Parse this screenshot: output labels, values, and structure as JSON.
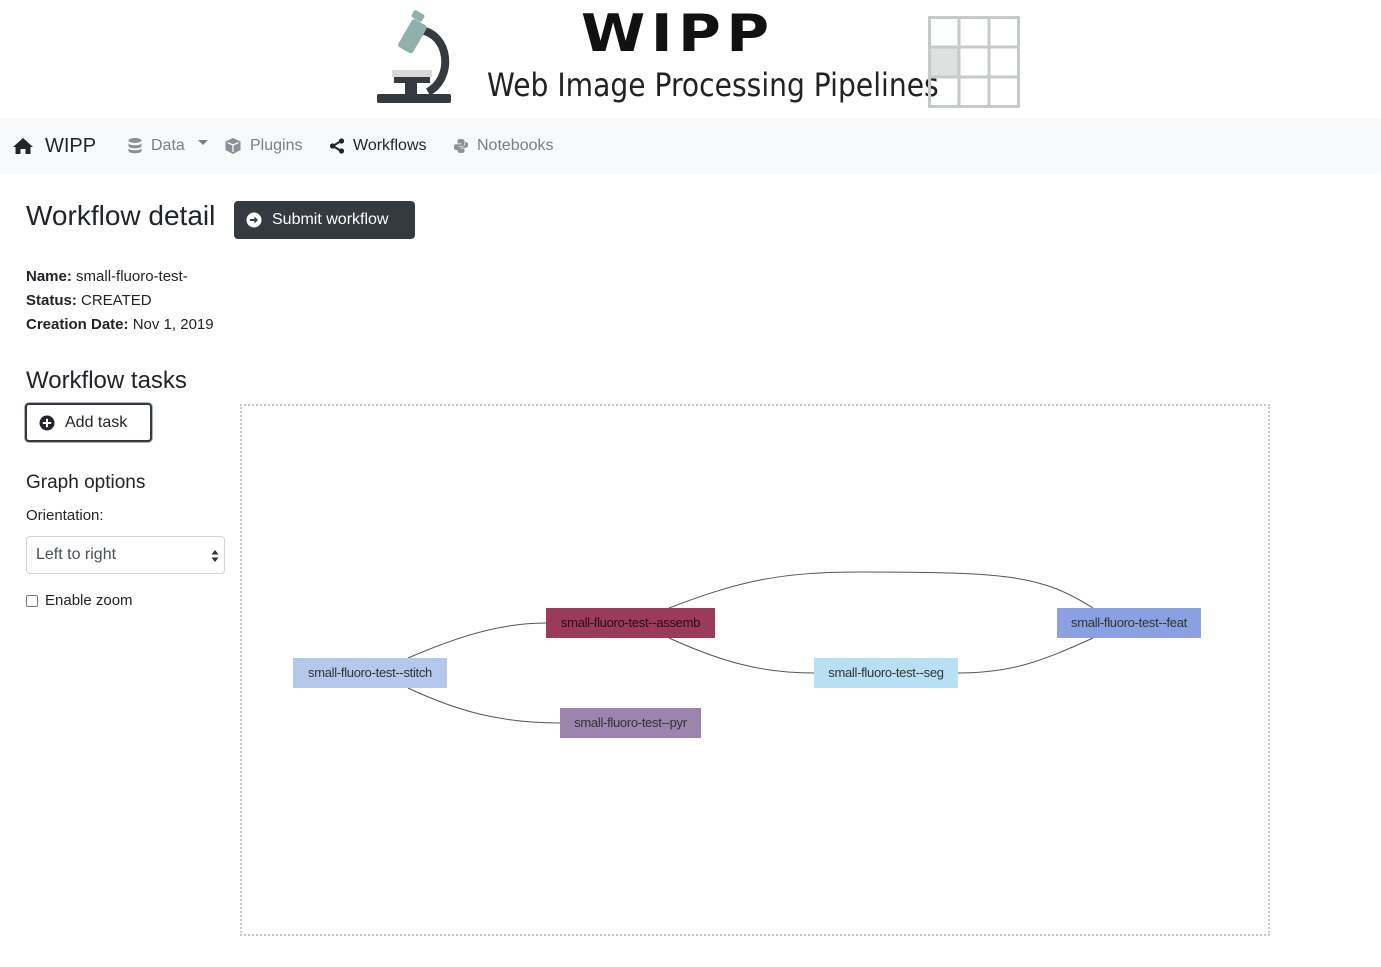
{
  "banner": {
    "wordmark": "WIPP",
    "subtitle": "Web Image Processing Pipelines"
  },
  "navbar": {
    "brand": "WIPP",
    "items": [
      {
        "label": "Data",
        "icon": "database-icon",
        "has_dropdown": true
      },
      {
        "label": "Plugins",
        "icon": "cube-icon"
      },
      {
        "label": "Workflows",
        "icon": "share-nodes-icon",
        "active": true
      },
      {
        "label": "Notebooks",
        "icon": "python-icon"
      }
    ]
  },
  "page": {
    "title": "Workflow detail",
    "submit_label": "Submit workflow"
  },
  "workflow": {
    "name_label": "Name:",
    "name": "small-fluoro-test-",
    "status_label": "Status:",
    "status": "CREATED",
    "date_label": "Creation Date:",
    "date": "Nov 1, 2019"
  },
  "tasks": {
    "title": "Workflow tasks",
    "add_label": "Add task"
  },
  "graph_options": {
    "title": "Graph options",
    "orientation_label": "Orientation:",
    "orientation_value": "Left to right",
    "zoom_label": "Enable zoom",
    "zoom_enabled": false
  },
  "graph": {
    "nodes": [
      {
        "id": "stitch",
        "label": "small-fluoro-test--stitch",
        "color": "#b4c7ec"
      },
      {
        "id": "assemb",
        "label": "small-fluoro-test--assemb",
        "color": "#9b3a5a"
      },
      {
        "id": "pyr",
        "label": "small-fluoro-test--pyr",
        "color": "#9c84ae"
      },
      {
        "id": "seg",
        "label": "small-fluoro-test--seg",
        "color": "#b8e0f5"
      },
      {
        "id": "feat",
        "label": "small-fluoro-test--feat",
        "color": "#8aa0e0"
      }
    ],
    "edges": [
      {
        "from": "stitch",
        "to": "assemb"
      },
      {
        "from": "stitch",
        "to": "pyr"
      },
      {
        "from": "assemb",
        "to": "seg"
      },
      {
        "from": "assemb",
        "to": "feat"
      },
      {
        "from": "seg",
        "to": "feat"
      }
    ]
  }
}
